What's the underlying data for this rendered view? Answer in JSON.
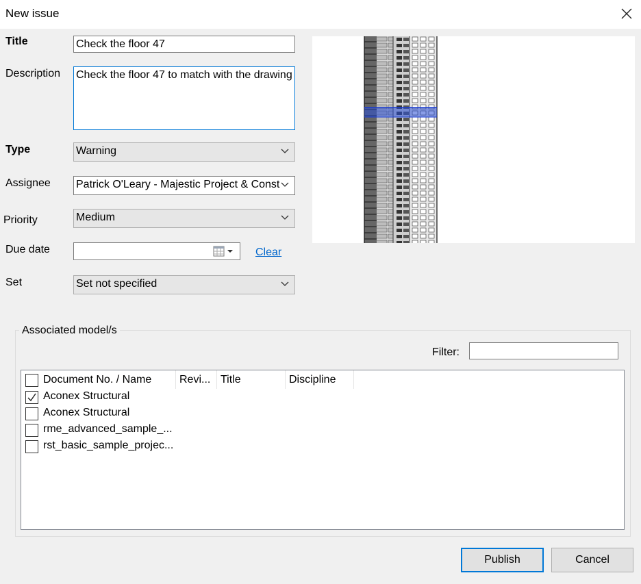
{
  "window": {
    "title": "New issue"
  },
  "form": {
    "title_label": "Title",
    "title_value": "Check the floor 47",
    "description_label": "Description",
    "description_value": "Check the floor 47 to match with the drawing",
    "type_label": "Type",
    "type_value": "Warning",
    "assignee_label": "Assignee",
    "assignee_value": "Patrick O'Leary - Majestic Project & Const",
    "priority_label": "Priority",
    "priority_value": "Medium",
    "due_date_label": "Due date",
    "due_date_value": "",
    "clear_link": "Clear",
    "set_label": "Set",
    "set_value": "Set not specified"
  },
  "models": {
    "group_label": "Associated model/s",
    "filter_label": "Filter:",
    "filter_value": "",
    "columns": [
      "Document No. / Name",
      "Revi...",
      "Title",
      "Discipline"
    ],
    "rows": [
      {
        "name": "Aconex Structural",
        "checked": true
      },
      {
        "name": "Aconex Structural",
        "checked": false
      },
      {
        "name": "rme_advanced_sample_...",
        "checked": false
      },
      {
        "name": "rst_basic_sample_projec...",
        "checked": false
      }
    ]
  },
  "buttons": {
    "publish": "Publish",
    "cancel": "Cancel"
  },
  "icons": {
    "close": "close-icon",
    "calendar": "calendar-icon",
    "dropdown": "chevron-down-icon",
    "check": "check-icon"
  },
  "colors": {
    "accent": "#0078d7",
    "link": "#0066cc",
    "highlight": "#2a4fd6"
  }
}
